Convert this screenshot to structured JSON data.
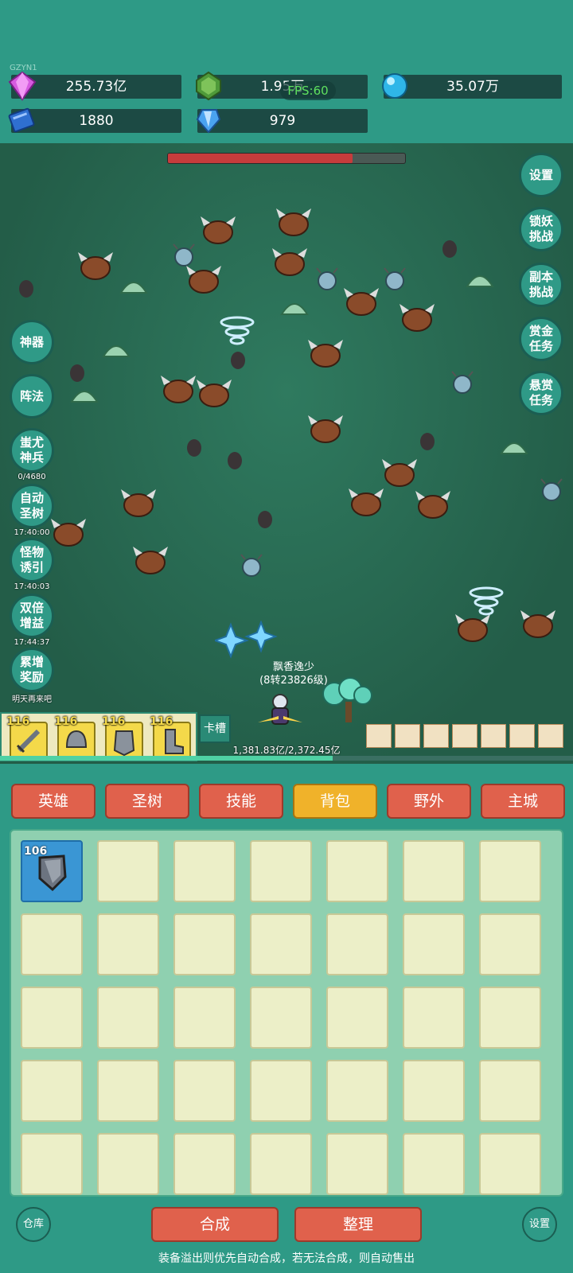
{
  "top": {
    "uid": "GZYN1",
    "resources": [
      {
        "icon": "purple-diamond-icon",
        "value": "255.73亿"
      },
      {
        "icon": "green-gem-icon",
        "value": "1.95万"
      },
      {
        "icon": "blue-orb-icon",
        "value": "35.07万"
      },
      {
        "icon": "blue-book-icon",
        "value": "1880"
      },
      {
        "icon": "blue-crystal-icon",
        "value": "979"
      }
    ],
    "fps": "FPS:60"
  },
  "right_buttons": [
    "设置",
    "锁妖\n挑战",
    "副本\n挑战",
    "赏金\n任务",
    "悬赏\n任务"
  ],
  "left_buttons": [
    {
      "label": "神器",
      "time": ""
    },
    {
      "label": "阵法",
      "time": ""
    },
    {
      "label": "蚩尤\n神兵",
      "time": "0/4680"
    },
    {
      "label": "自动\n圣树",
      "time": "17:40:00"
    },
    {
      "label": "怪物\n诱引",
      "time": "17:40:03"
    },
    {
      "label": "双倍\n增益",
      "time": "17:44:37"
    },
    {
      "label": "累增\n奖励",
      "time": "明天再来吧"
    }
  ],
  "player": {
    "name": "飘香逸少",
    "level": "(8转23826级)"
  },
  "equip_slots": [
    {
      "icon": "sword-icon",
      "level": "116"
    },
    {
      "icon": "helmet-icon",
      "level": "116"
    },
    {
      "icon": "armor-icon",
      "level": "116"
    },
    {
      "icon": "boots-icon",
      "level": "116"
    }
  ],
  "card_slot_label": "卡槽",
  "xp": {
    "text": "1,381.83亿/2,372.45亿",
    "fraction": 0.58
  },
  "boss_hp_fraction": 0.78,
  "tabs": [
    {
      "label": "英雄",
      "active": false
    },
    {
      "label": "圣树",
      "active": false
    },
    {
      "label": "技能",
      "active": false
    },
    {
      "label": "背包",
      "active": true
    },
    {
      "label": "野外",
      "active": false
    },
    {
      "label": "主城",
      "active": false
    }
  ],
  "bag_items": [
    {
      "icon": "shield-icon",
      "level": "106"
    }
  ],
  "bottom": {
    "warehouse": "仓库",
    "merge": "合成",
    "sort": "整理",
    "settings": "设置",
    "tip": "装备溢出则优先自动合成，若无法合成，则自动售出"
  },
  "colors": {
    "accent": "#2e9a86",
    "tab": "#e0614c",
    "tab_active": "#f0b22a",
    "bag_bg": "#8fd0b0",
    "cell": "#ecefc8",
    "item_cell": "#3a96d4"
  }
}
